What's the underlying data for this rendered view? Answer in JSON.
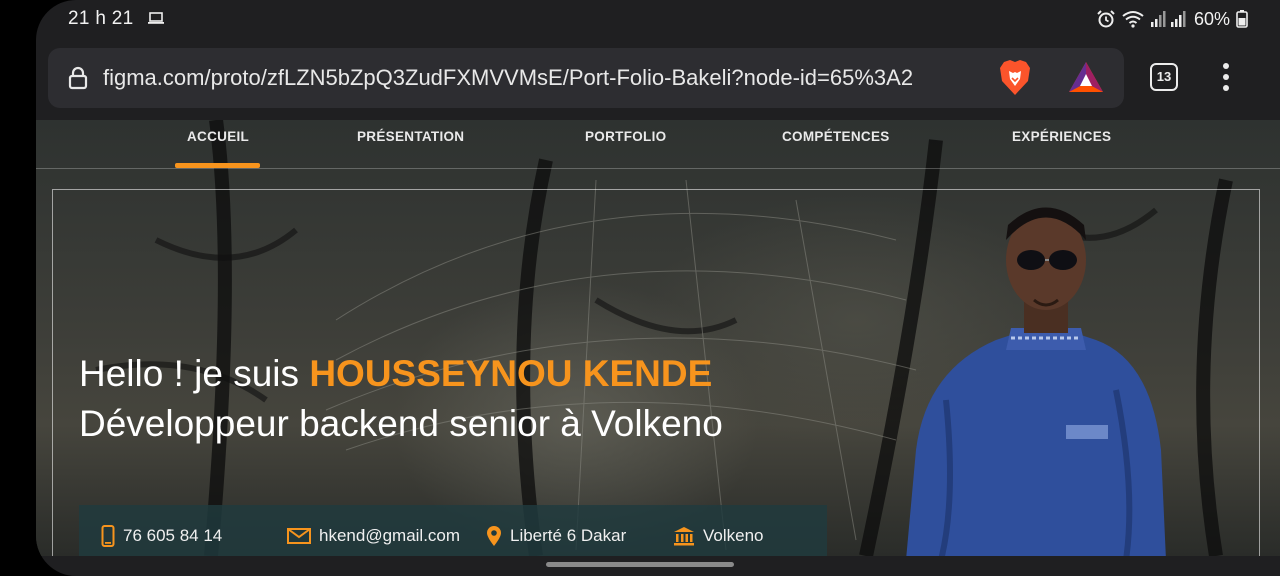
{
  "status_bar": {
    "time": "21 h 21",
    "battery": "60%"
  },
  "browser": {
    "url": "figma.com/proto/zfLZN5bZpQ3ZudFXMVVMsE/Port-Folio-Bakeli?node-id=65%3A2",
    "tab_count": "13"
  },
  "site": {
    "nav": [
      "ACCUEIL",
      "PRÉSENTATION",
      "PORTFOLIO",
      "COMPÉTENCES",
      "EXPÉRIENCES"
    ],
    "hero": {
      "greeting": "Hello ! je suis ",
      "name": "HOUSSEYNOU KENDE",
      "role": "Développeur backend senior à Volkeno"
    },
    "contact": {
      "phone": "76 605 84 14",
      "email": "hkend@gmail.com",
      "location": "Liberté 6 Dakar",
      "company": "Volkeno"
    }
  },
  "colors": {
    "accent": "#f7941d",
    "contact_bar": "#203a3e",
    "url_bar": "#2d2d31"
  },
  "icons": [
    "laptop-icon",
    "alarm-icon",
    "wifi-icon",
    "signal-icon",
    "battery-icon",
    "lock-icon",
    "brave-lion-icon",
    "bat-triangle-icon",
    "tabs-counter-icon",
    "more-vert-icon",
    "phone-icon",
    "mail-icon",
    "location-pin-icon",
    "bank-icon"
  ]
}
